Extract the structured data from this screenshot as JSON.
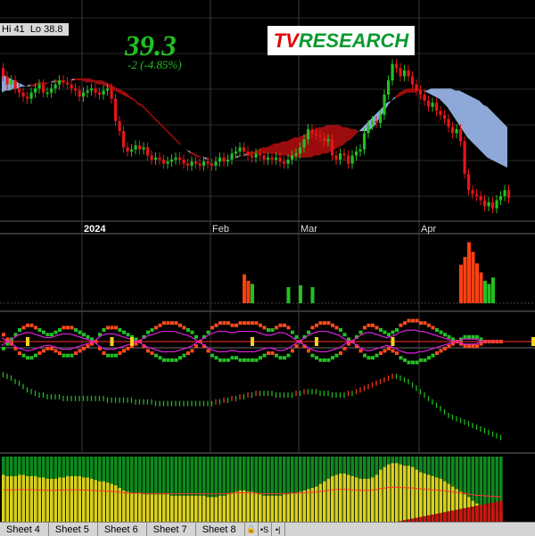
{
  "header": {
    "hi_label": "Hi 41",
    "lo_label": "Lo 38.8"
  },
  "price": {
    "last": "39.3",
    "change": "-2 (-4.85%)"
  },
  "logo": {
    "part1": "TV",
    "part2": "RESEARCH"
  },
  "colors": {
    "up": "#22c022",
    "down": "#e51515",
    "cloud_bull": "#8ea8d8",
    "cloud_bear": "#9b0d0d",
    "background": "#000000"
  },
  "chart_data": {
    "type": "candlestick",
    "x_labels": [
      {
        "label": "2024",
        "index": 20
      },
      {
        "label": "Feb",
        "index": 52
      },
      {
        "label": "Mar",
        "index": 74
      },
      {
        "label": "Apr",
        "index": 104
      }
    ],
    "ohlc_open": [
      44.4,
      44.0,
      43.6,
      43.8,
      43.4,
      43.2,
      43.0,
      42.9,
      43.2,
      43.4,
      43.6,
      43.2,
      43.2,
      43.4,
      43.6,
      43.8,
      43.7,
      43.6,
      43.4,
      43.3,
      43.0,
      43.2,
      43.3,
      43.4,
      43.2,
      43.1,
      43.3,
      43.4,
      42.9,
      41.8,
      41.3,
      40.5,
      40.3,
      40.4,
      40.6,
      40.4,
      40.5,
      40.1,
      39.9,
      40.0,
      39.9,
      39.7,
      39.8,
      39.9,
      40.0,
      39.9,
      39.7,
      39.6,
      39.8,
      39.7,
      39.6,
      39.8,
      39.7,
      39.6,
      39.8,
      40.0,
      39.8,
      39.9,
      40.2,
      40.3,
      40.5,
      40.3,
      40.1,
      40.0,
      40.2,
      40.1,
      39.9,
      40.0,
      39.9,
      40.0,
      39.8,
      39.7,
      39.9,
      40.1,
      40.2,
      40.5,
      40.9,
      41.4,
      41.2,
      41.1,
      41.0,
      40.8,
      40.9,
      40.1,
      39.9,
      40.2,
      40.1,
      39.7,
      40.1,
      40.3,
      40.4,
      41.2,
      41.6,
      41.8,
      41.7,
      42.1,
      43.1,
      43.8,
      44.6,
      44.4,
      44.0,
      44.3,
      44.0,
      43.6,
      43.3,
      43.1,
      42.8,
      42.5,
      42.7,
      42.3,
      42.1,
      41.9,
      41.5,
      41.2,
      41.4,
      40.8,
      39.2,
      38.4,
      38.2,
      38.1,
      37.9,
      37.6,
      37.8,
      37.5,
      37.9,
      38.1,
      38.4
    ],
    "ohlc_close": [
      44.0,
      43.6,
      43.8,
      43.4,
      43.2,
      43.0,
      42.9,
      43.2,
      43.4,
      43.6,
      43.2,
      43.2,
      43.4,
      43.6,
      43.8,
      43.7,
      43.6,
      43.4,
      43.3,
      43.0,
      43.2,
      43.3,
      43.4,
      43.2,
      43.1,
      43.3,
      43.4,
      42.9,
      41.8,
      41.3,
      40.5,
      40.3,
      40.4,
      40.6,
      40.4,
      40.5,
      40.1,
      39.9,
      40.0,
      39.9,
      39.7,
      39.8,
      39.9,
      40.0,
      39.9,
      39.7,
      39.6,
      39.8,
      39.7,
      39.6,
      39.8,
      39.7,
      39.6,
      39.8,
      40.0,
      39.8,
      39.9,
      40.2,
      40.3,
      40.5,
      40.3,
      40.1,
      40.0,
      40.2,
      40.1,
      39.9,
      40.0,
      39.9,
      40.0,
      39.8,
      39.7,
      39.9,
      40.1,
      40.2,
      40.5,
      40.9,
      41.4,
      41.2,
      41.1,
      41.0,
      40.8,
      40.9,
      40.1,
      39.9,
      40.2,
      40.1,
      39.7,
      40.1,
      40.3,
      40.4,
      41.2,
      41.6,
      41.8,
      41.7,
      42.1,
      43.1,
      43.8,
      44.6,
      44.4,
      44.0,
      44.3,
      44.0,
      43.6,
      43.3,
      43.1,
      42.8,
      42.5,
      42.7,
      42.3,
      42.1,
      41.9,
      41.5,
      41.2,
      41.4,
      40.8,
      39.2,
      38.4,
      38.2,
      38.1,
      37.9,
      37.6,
      37.8,
      37.5,
      37.9,
      38.1,
      38.4,
      38.0
    ],
    "price_ylim": [
      37.0,
      46.0
    ],
    "cloud_upper": [
      43.2,
      43.3,
      43.3,
      43.4,
      43.4,
      43.5,
      43.5,
      43.6,
      43.6,
      43.7,
      43.7,
      43.7,
      43.7,
      43.8,
      43.8,
      43.8,
      43.8,
      43.8,
      43.9,
      43.9,
      43.9,
      43.9,
      43.9,
      43.8,
      43.8,
      43.8,
      43.7,
      43.6,
      43.5,
      43.4,
      43.3,
      43.2,
      43.0,
      42.9,
      42.7,
      42.6,
      42.4,
      42.2,
      42.0,
      41.8,
      41.6,
      41.4,
      41.2,
      41.0,
      40.8,
      40.6,
      40.4,
      40.3,
      40.2,
      40.1,
      40.0,
      40.0,
      39.9,
      39.9,
      39.9,
      39.9,
      39.9,
      40.0,
      40.0,
      40.1,
      40.1,
      40.2,
      40.3,
      40.3,
      40.4,
      40.5,
      40.5,
      40.6,
      40.7,
      40.7,
      40.8,
      40.8,
      40.9,
      41.0,
      41.0,
      41.1,
      41.2,
      41.3,
      41.4,
      41.5,
      41.5,
      41.6,
      41.6,
      41.6,
      41.6,
      41.5,
      41.5,
      41.4,
      41.4,
      41.3,
      41.3,
      41.3,
      41.4,
      41.6,
      41.9,
      42.2,
      42.5,
      42.8,
      43.0,
      43.2,
      43.3,
      43.4,
      43.4,
      43.4,
      43.4,
      43.3,
      43.2,
      43.1,
      43.0,
      42.9,
      42.7,
      42.5,
      42.2,
      41.9,
      41.6,
      41.3,
      41.0,
      40.8,
      40.6,
      40.4,
      40.2,
      40.0,
      39.9,
      39.8,
      39.7,
      39.6,
      39.5
    ],
    "cloud_lower": [
      44.2,
      44.0,
      43.9,
      43.8,
      43.7,
      43.6,
      43.5,
      43.5,
      43.5,
      43.6,
      43.6,
      43.6,
      43.7,
      43.7,
      43.7,
      43.7,
      43.8,
      43.8,
      43.8,
      43.8,
      43.8,
      43.7,
      43.7,
      43.7,
      43.6,
      43.6,
      43.5,
      43.4,
      43.3,
      43.2,
      43.1,
      43.0,
      42.9,
      42.8,
      42.6,
      42.5,
      42.3,
      42.1,
      41.9,
      41.7,
      41.5,
      41.3,
      41.1,
      40.9,
      40.7,
      40.6,
      40.4,
      40.2,
      40.1,
      40.0,
      40.0,
      39.9,
      39.9,
      39.9,
      39.9,
      39.9,
      39.9,
      40.0,
      40.0,
      40.0,
      40.1,
      40.1,
      40.1,
      40.2,
      40.2,
      40.2,
      40.2,
      40.2,
      40.2,
      40.1,
      40.1,
      40.1,
      40.0,
      40.0,
      40.0,
      40.0,
      40.0,
      40.0,
      40.1,
      40.1,
      40.2,
      40.2,
      40.3,
      40.4,
      40.5,
      40.6,
      40.8,
      40.9,
      41.1,
      41.3,
      41.5,
      41.7,
      41.9,
      42.1,
      42.3,
      42.5,
      42.7,
      42.8,
      42.9,
      43.0,
      43.1,
      43.2,
      43.2,
      43.2,
      43.3,
      43.3,
      43.3,
      43.4,
      43.4,
      43.4,
      43.4,
      43.4,
      43.4,
      43.3,
      43.3,
      43.2,
      43.1,
      43.0,
      42.9,
      42.8,
      42.6,
      42.5,
      42.3,
      42.1,
      41.9,
      41.7,
      41.5
    ],
    "volume_bars": [
      {
        "index": 60,
        "value": 0.45,
        "up": false
      },
      {
        "index": 61,
        "value": 0.35,
        "up": false
      },
      {
        "index": 62,
        "value": 0.3,
        "up": true
      },
      {
        "index": 71,
        "value": 0.25,
        "up": true
      },
      {
        "index": 74,
        "value": 0.28,
        "up": true
      },
      {
        "index": 77,
        "value": 0.25,
        "up": true
      },
      {
        "index": 114,
        "value": 0.6,
        "up": false
      },
      {
        "index": 115,
        "value": 0.72,
        "up": false
      },
      {
        "index": 116,
        "value": 0.95,
        "up": false
      },
      {
        "index": 117,
        "value": 0.8,
        "up": false
      },
      {
        "index": 118,
        "value": 0.62,
        "up": false
      },
      {
        "index": 119,
        "value": 0.48,
        "up": false
      },
      {
        "index": 120,
        "value": 0.35,
        "up": true
      },
      {
        "index": 121,
        "value": 0.3,
        "up": true
      },
      {
        "index": 122,
        "value": 0.4,
        "up": true
      }
    ],
    "oscillator_x": [
      0,
      1,
      2,
      3,
      4,
      5,
      6,
      7,
      8,
      9,
      10,
      11,
      12,
      13,
      14,
      15,
      16,
      17,
      18,
      19,
      20,
      21,
      22,
      23,
      24,
      25,
      26,
      27,
      28,
      29,
      30,
      31,
      32,
      33,
      34,
      35,
      36,
      37,
      38,
      39,
      40,
      41,
      42,
      43,
      44,
      45,
      46,
      47,
      48,
      49,
      50,
      51,
      52,
      53,
      54,
      55,
      56,
      57,
      58,
      59,
      60,
      61,
      62,
      63,
      64,
      65,
      66,
      67,
      68,
      69,
      70,
      71,
      72,
      73,
      74,
      75,
      76,
      77,
      78,
      79,
      80,
      81,
      82,
      83,
      84,
      85,
      86,
      87,
      88,
      89,
      90,
      91,
      92,
      93,
      94,
      95,
      96,
      97,
      98,
      99,
      100,
      101,
      102,
      103,
      104,
      105,
      106,
      107,
      108,
      109,
      110,
      111,
      112,
      113,
      114,
      115,
      116,
      117,
      118,
      119,
      120,
      121,
      122,
      123,
      124
    ],
    "oscillator_upper": [
      -0.3,
      -0.1,
      0.1,
      0.3,
      0.5,
      0.6,
      0.7,
      0.7,
      0.6,
      0.5,
      0.4,
      0.3,
      0.3,
      0.4,
      0.5,
      0.6,
      0.6,
      0.6,
      0.5,
      0.4,
      0.3,
      0.2,
      0.1,
      0.0,
      0.3,
      0.5,
      0.6,
      0.6,
      0.6,
      0.5,
      0.4,
      0.3,
      0.2,
      0.1,
      0.0,
      0.2,
      0.4,
      0.5,
      0.6,
      0.7,
      0.8,
      0.8,
      0.8,
      0.8,
      0.7,
      0.6,
      0.5,
      0.4,
      0.2,
      0.0,
      0.2,
      0.4,
      0.6,
      0.7,
      0.8,
      0.8,
      0.8,
      0.7,
      0.7,
      0.8,
      0.8,
      0.8,
      0.8,
      0.8,
      0.7,
      0.6,
      0.5,
      0.5,
      0.6,
      0.7,
      0.7,
      0.6,
      0.4,
      0.2,
      0.0,
      0.2,
      0.4,
      0.6,
      0.7,
      0.8,
      0.8,
      0.8,
      0.7,
      0.6,
      0.5,
      0.3,
      0.1,
      0.0,
      0.2,
      0.4,
      0.6,
      0.7,
      0.7,
      0.6,
      0.5,
      0.4,
      0.3,
      0.4,
      0.5,
      0.7,
      0.8,
      0.9,
      0.9,
      0.9,
      0.8,
      0.8,
      0.7,
      0.6,
      0.5,
      0.4,
      0.3,
      0.2,
      0.1,
      0.0,
      0.1,
      0.2,
      0.2,
      0.2,
      0.2,
      0.1,
      0.0,
      0.0,
      0.0,
      0.0,
      0.0
    ],
    "oscillator_markers": [
      6,
      27,
      32,
      62,
      78,
      97,
      132
    ],
    "trend_values": [
      42,
      41,
      40,
      38,
      37,
      35,
      33,
      32,
      31,
      30,
      30,
      29,
      29,
      29,
      29,
      28,
      28,
      28,
      28,
      28,
      28,
      28,
      28,
      28,
      28,
      28,
      27,
      27,
      27,
      27,
      27,
      27,
      27,
      26,
      26,
      26,
      26,
      26,
      25,
      25,
      25,
      25,
      25,
      25,
      25,
      25,
      25,
      25,
      25,
      25,
      25,
      25,
      25,
      26,
      26,
      27,
      27,
      28,
      28,
      29,
      29,
      30,
      30,
      31,
      31,
      31,
      31,
      31,
      30,
      30,
      30,
      30,
      30,
      31,
      31,
      32,
      32,
      32,
      32,
      31,
      31,
      31,
      30,
      30,
      30,
      30,
      31,
      31,
      32,
      33,
      34,
      35,
      36,
      37,
      38,
      39,
      40,
      41,
      41,
      40,
      39,
      38,
      36,
      34,
      32,
      30,
      28,
      26,
      24,
      22,
      20,
      18,
      17,
      16,
      15,
      14,
      13,
      12,
      11,
      10,
      9,
      8,
      7,
      6,
      5
    ],
    "trend_ylim": [
      0,
      50
    ],
    "histogram_values": [
      0.72,
      0.7,
      0.7,
      0.7,
      0.72,
      0.72,
      0.7,
      0.7,
      0.7,
      0.68,
      0.68,
      0.66,
      0.66,
      0.66,
      0.68,
      0.68,
      0.7,
      0.7,
      0.7,
      0.7,
      0.68,
      0.68,
      0.66,
      0.64,
      0.62,
      0.62,
      0.6,
      0.58,
      0.56,
      0.52,
      0.48,
      0.46,
      0.44,
      0.44,
      0.44,
      0.42,
      0.42,
      0.42,
      0.42,
      0.42,
      0.42,
      0.42,
      0.4,
      0.4,
      0.4,
      0.4,
      0.4,
      0.4,
      0.4,
      0.4,
      0.4,
      0.38,
      0.38,
      0.38,
      0.4,
      0.4,
      0.42,
      0.44,
      0.46,
      0.48,
      0.48,
      0.46,
      0.46,
      0.44,
      0.42,
      0.4,
      0.4,
      0.4,
      0.4,
      0.4,
      0.42,
      0.42,
      0.44,
      0.44,
      0.46,
      0.48,
      0.5,
      0.52,
      0.54,
      0.58,
      0.62,
      0.66,
      0.7,
      0.72,
      0.74,
      0.74,
      0.72,
      0.7,
      0.68,
      0.66,
      0.66,
      0.66,
      0.68,
      0.72,
      0.8,
      0.84,
      0.88,
      0.9,
      0.9,
      0.88,
      0.86,
      0.86,
      0.84,
      0.8,
      0.76,
      0.74,
      0.72,
      0.7,
      0.68,
      0.66,
      0.62,
      0.58,
      0.54,
      0.5,
      0.46,
      0.42,
      0.38,
      0.32,
      0.28,
      0.26,
      0.24,
      0.22,
      0.2,
      0.18,
      0.16
    ]
  },
  "tabs": {
    "items": [
      {
        "label": "Sheet 4"
      },
      {
        "label": "Sheet 5"
      },
      {
        "label": "Sheet 6"
      },
      {
        "label": "Sheet 7"
      },
      {
        "label": "Sheet 8"
      }
    ],
    "ctrl_lock": "🔒",
    "ctrl_s": "•S",
    "ctrl_next": "•|"
  }
}
